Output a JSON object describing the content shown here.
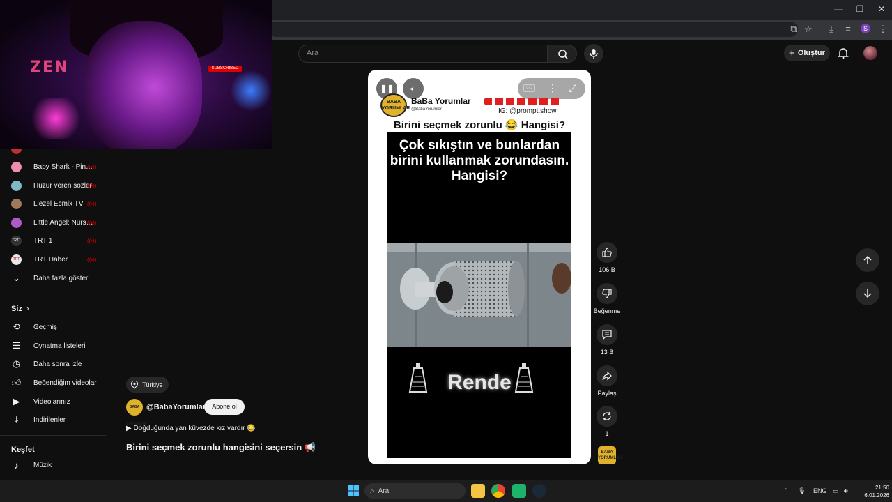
{
  "colors": {
    "accent_red": "#cc0000",
    "bg": "#0f0f0f",
    "chip": "#272727",
    "brand_yellow": "#e0b12a"
  },
  "header": {
    "search_placeholder": "Ara",
    "create_label": "Oluştur",
    "icons": [
      "search-icon",
      "mic-icon",
      "plus-icon",
      "bell-icon",
      "avatar"
    ]
  },
  "pip": {
    "logo_text": "ZEN",
    "subscribed_badge": "SUBSCRIBED"
  },
  "sidebar": {
    "subscriptions": [
      {
        "label": "Baby Shark - Pin…"
      },
      {
        "label": "Huzur veren sözler"
      },
      {
        "label": "Liezel Ecmix TV"
      },
      {
        "label": "Little Angel: Nurs…"
      },
      {
        "label": "TRT 1",
        "avatar_text": "TRT1"
      },
      {
        "label": "TRT Haber",
        "avatar_text": "TRT"
      }
    ],
    "show_more": "Daha fazla göster",
    "you_section": "Siz",
    "you_items": [
      {
        "label": "Geçmiş",
        "icon": "history-icon"
      },
      {
        "label": "Oynatma listeleri",
        "icon": "playlist-icon"
      },
      {
        "label": "Daha sonra izle",
        "icon": "clock-icon"
      },
      {
        "label": "Beğendiğim videolar",
        "icon": "thumb-up-icon"
      },
      {
        "label": "Videolarınız",
        "icon": "video-icon"
      },
      {
        "label": "İndirilenler",
        "icon": "download-icon"
      }
    ],
    "explore_section": "Keşfet",
    "explore_items": [
      {
        "label": "Müzik",
        "icon": "music-icon"
      }
    ]
  },
  "video": {
    "channel_name": "BaBa Yorumlar",
    "channel_handle": "@BabaYorumlar",
    "channel_logo_text": "BABA YORUMLAR",
    "ig_text": "IG: @prompt.show",
    "title_overlay": "Birini seçmek zorunlu 😂 Hangisi?",
    "question": "Çok sıkıştın ve bunlardan birini kullanmak zorundasın. Hangisi?",
    "item_label": "Rende"
  },
  "actions": {
    "likes": "106 B",
    "dislike_label": "Beğenme",
    "comments": "13 B",
    "share_label": "Paylaş",
    "remix_count": "1"
  },
  "description": {
    "location": "Türkiye",
    "handle": "@BabaYorumlar",
    "subscribe_label": "Abone ol",
    "line": "▶ Doğduğunda yan küvezde kız vardır 😂",
    "title": "Birini seçmek zorunlu hangisini seçersin 📢"
  },
  "taskbar": {
    "search_label": "Ara",
    "lang": "ENG",
    "time": "21:50",
    "date": "6.01.2026"
  }
}
